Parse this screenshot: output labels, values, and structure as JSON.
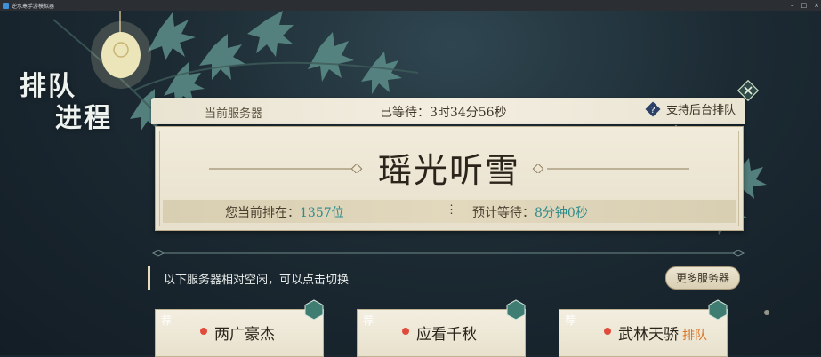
{
  "window": {
    "title": "逆水寒手游模拟器",
    "controls": [
      "–",
      "□",
      "×"
    ]
  },
  "title_lines": [
    "排队",
    "进程"
  ],
  "queue": {
    "current_server_label": "当前服务器",
    "waited": "已等待：3时34分56秒",
    "background_queue": "支持后台排队",
    "server_name": "瑶光听雪",
    "rank_label": "您当前排在：",
    "rank_value": "1357位",
    "separator": "⋮",
    "eta_label": "预计等待：",
    "eta_value": "8分钟0秒"
  },
  "notice": {
    "text": "以下服务器相对空闲，可以点击切换",
    "more_button": "更多服务器"
  },
  "servers": [
    {
      "name": "两广豪杰",
      "status": "",
      "tag": "荐"
    },
    {
      "name": "应看千秋",
      "status": "",
      "tag": "荐"
    },
    {
      "name": "武林天骄",
      "status": "排队",
      "tag": "荐"
    }
  ],
  "colors": {
    "accent_teal": "#2f8c8c",
    "status_red": "#e04b3c",
    "queue_orange": "#d8772a"
  },
  "icons": [
    "close-icon",
    "help-icon",
    "recommend-badge-icon",
    "lantern-icon"
  ]
}
